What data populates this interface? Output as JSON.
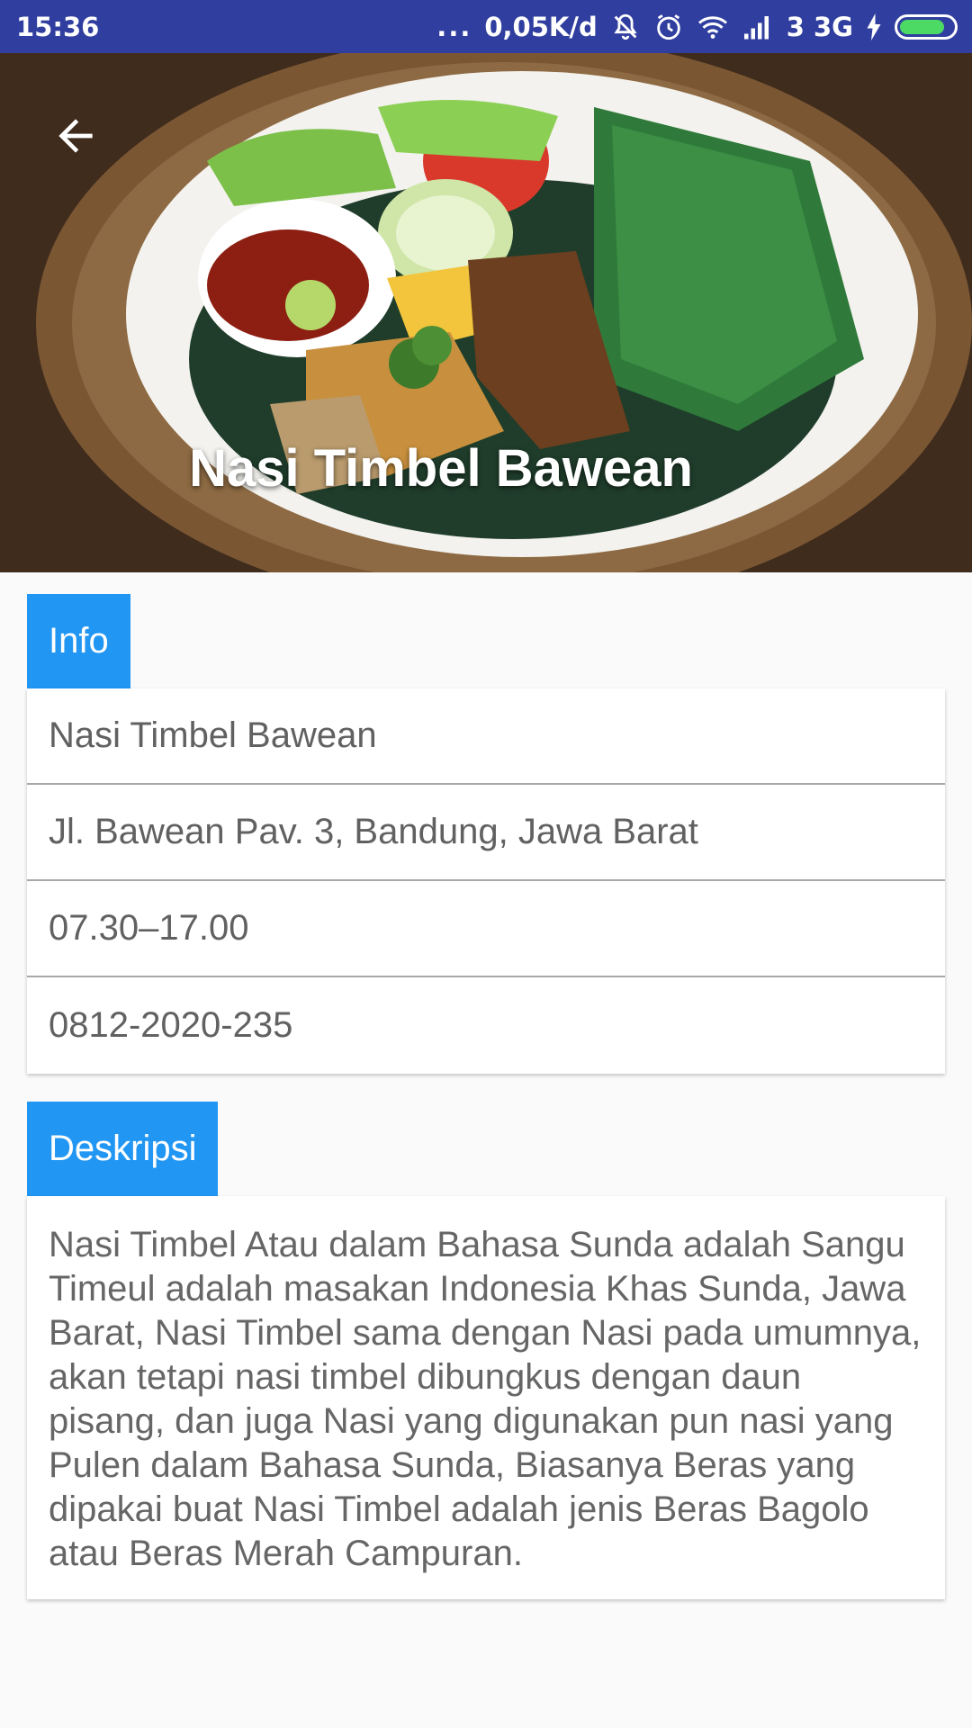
{
  "status_bar": {
    "time": "15:36",
    "dots": "...",
    "network_speed": "0,05K/d",
    "network_label": "3 3G",
    "battery_level": 0.85,
    "icons": [
      "mute-icon",
      "alarm-icon",
      "wifi-icon",
      "signal-icon",
      "charging-icon",
      "battery-icon"
    ],
    "colors": {
      "background": "#303f9f",
      "battery": "#4cd964"
    }
  },
  "header": {
    "title": "Nasi Timbel Bawean",
    "back_icon": "arrow-back-icon",
    "image": "food-photo"
  },
  "info": {
    "label": "Info",
    "rows": [
      "Nasi Timbel Bawean",
      "Jl. Bawean Pav. 3, Bandung, Jawa Barat",
      "07.30–17.00",
      "0812-2020-235"
    ]
  },
  "description": {
    "label": "Deskripsi",
    "text": "Nasi Timbel Atau dalam Bahasa Sunda adalah Sangu Timeul adalah masakan Indonesia Khas Sunda, Jawa Barat, Nasi Timbel sama dengan Nasi pada umumnya, akan tetapi nasi timbel dibungkus dengan daun pisang, dan juga Nasi yang digunakan pun nasi yang Pulen dalam Bahasa Sunda, Biasanya Beras yang dipakai buat Nasi Timbel adalah jenis Beras Bagolo atau Beras Merah Campuran."
  },
  "colors": {
    "accent": "#2196f3",
    "text": "#616161",
    "background": "#fafafa"
  }
}
